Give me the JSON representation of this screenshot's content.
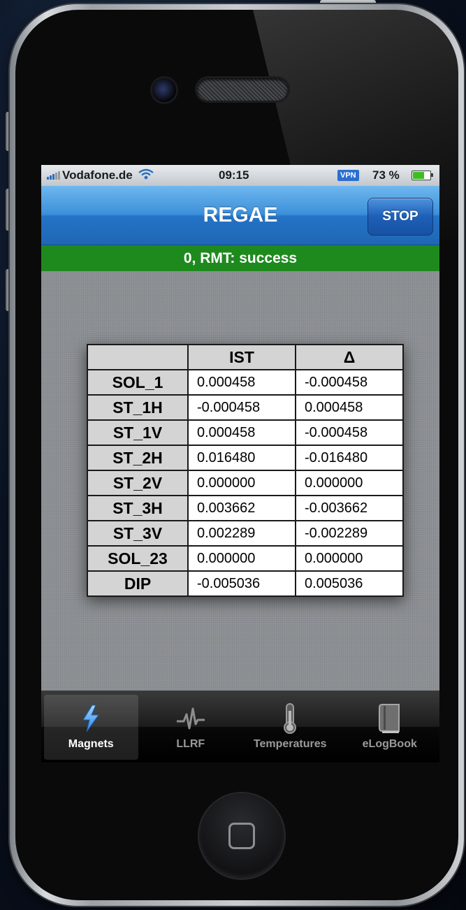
{
  "status_bar": {
    "carrier": "Vodafone.de",
    "time": "09:15",
    "vpn": "VPN",
    "battery_percent": "73 %",
    "battery_level": 0.73
  },
  "nav_bar": {
    "title": "REGAE",
    "stop_label": "STOP"
  },
  "status_message": "0, RMT: success",
  "table": {
    "columns": [
      "",
      "IST",
      "Δ"
    ],
    "rows": [
      {
        "name": "SOL_1",
        "ist": "0.000458",
        "delta": "-0.000458"
      },
      {
        "name": "ST_1H",
        "ist": "-0.000458",
        "delta": "0.000458"
      },
      {
        "name": "ST_1V",
        "ist": "0.000458",
        "delta": "-0.000458"
      },
      {
        "name": "ST_2H",
        "ist": "0.016480",
        "delta": "-0.016480"
      },
      {
        "name": "ST_2V",
        "ist": "0.000000",
        "delta": "0.000000"
      },
      {
        "name": "ST_3H",
        "ist": "0.003662",
        "delta": "-0.003662"
      },
      {
        "name": "ST_3V",
        "ist": "0.002289",
        "delta": "-0.002289"
      },
      {
        "name": "SOL_23",
        "ist": "0.000000",
        "delta": "0.000000"
      },
      {
        "name": "DIP",
        "ist": "-0.005036",
        "delta": "0.005036"
      }
    ]
  },
  "tabs": [
    {
      "label": "Magnets",
      "icon": "lightning-icon",
      "active": true
    },
    {
      "label": "LLRF",
      "icon": "waveform-icon",
      "active": false
    },
    {
      "label": "Temperatures",
      "icon": "thermometer-icon",
      "active": false
    },
    {
      "label": "eLogBook",
      "icon": "book-icon",
      "active": false
    }
  ],
  "colors": {
    "nav_blue": "#2473c6",
    "status_green": "#1e8a1e",
    "accent_icon": "#4aa3ff"
  }
}
